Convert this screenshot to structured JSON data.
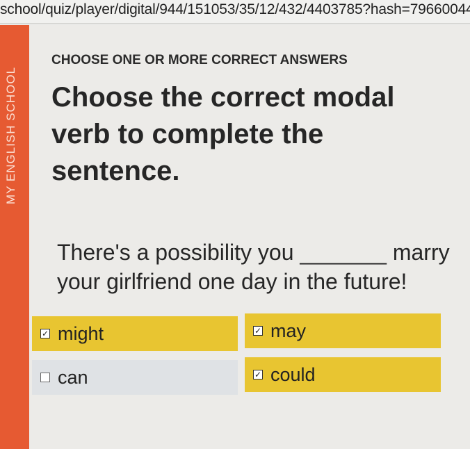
{
  "browser": {
    "url": "school/quiz/player/digital/944/151053/35/12/432/4403785?hash=79660044"
  },
  "sidebar": {
    "brand": "MY ENGLISH SCHOOL"
  },
  "quiz": {
    "instruction": "CHOOSE ONE OR MORE CORRECT ANSWERS",
    "question": "Choose the correct modal verb to complete the sentence.",
    "sentence": "There's a possibility you _______ marry your girlfriend one day in the future!",
    "options": [
      {
        "label": "might",
        "checked": true,
        "check_glyph": "✓"
      },
      {
        "label": "may",
        "checked": true,
        "check_glyph": "✓"
      },
      {
        "label": "can",
        "checked": false,
        "check_glyph": ""
      },
      {
        "label": "could",
        "checked": true,
        "check_glyph": "✓"
      }
    ]
  },
  "colors": {
    "sidebar": "#e65a32",
    "selected_option": "#e8c531",
    "unselected_option": "#dfe2e5"
  }
}
